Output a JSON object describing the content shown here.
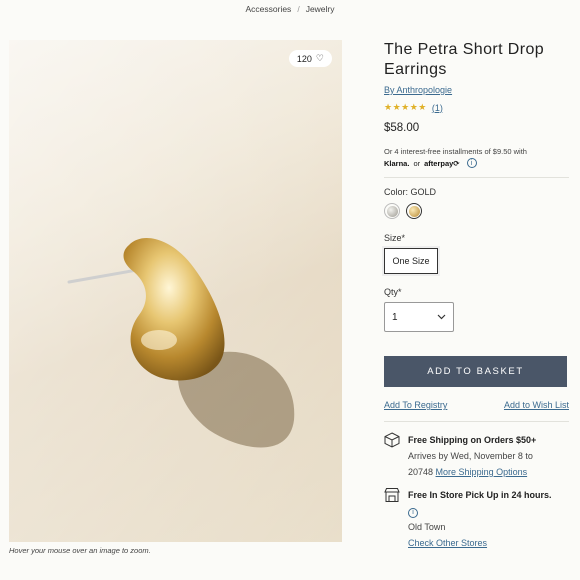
{
  "breadcrumb": {
    "items": [
      "Accessories",
      "Jewelry"
    ],
    "separator": "/"
  },
  "image": {
    "likes": "120",
    "zoom_hint": "Hover your mouse over an image to zoom."
  },
  "product": {
    "title": "The Petra Short Drop Earrings",
    "brand": "By Anthropologie",
    "stars": "★★★★★",
    "review_count": "(1)",
    "price": "$58.00",
    "installments": "Or 4 interest-free installments of $9.50 with",
    "klarna": "Klarna.",
    "or": "or",
    "afterpay": "afterpay⟳"
  },
  "color": {
    "label": "Color:",
    "value": "GOLD",
    "swatch_colors": [
      "#c9c6bd",
      "#d9b46a"
    ]
  },
  "size": {
    "label": "Size*",
    "option": "One Size"
  },
  "qty": {
    "label": "Qty*",
    "value": "1"
  },
  "actions": {
    "add_to_basket": "ADD TO BASKET",
    "add_to_registry": "Add To Registry",
    "add_to_wishlist": "Add to Wish List"
  },
  "shipping": {
    "title": "Free Shipping on Orders $50+",
    "arrives": "Arrives by Wed, November 8 to",
    "zip": "20748",
    "more_options": "More Shipping Options"
  },
  "pickup": {
    "title": "Free In Store Pick Up in 24 hours.",
    "store": "Old Town",
    "check_other": "Check Other Stores"
  },
  "colors": {
    "accent_link": "#3b6a8f",
    "button_bg": "#4a5668",
    "star": "#e0b128"
  }
}
